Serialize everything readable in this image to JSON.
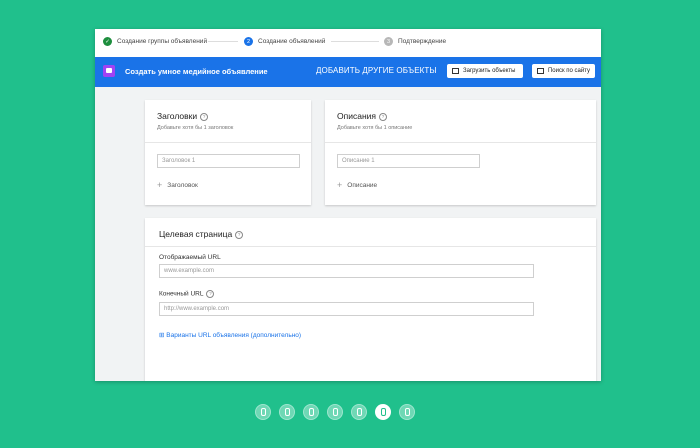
{
  "stepper": {
    "steps": [
      {
        "label": "Создание группы объявлений",
        "status": "done",
        "marker": "✓"
      },
      {
        "label": "Создание объявлений",
        "status": "current",
        "marker": "2"
      },
      {
        "label": "Подтверждение",
        "status": "pending",
        "marker": "3"
      }
    ]
  },
  "toolbar": {
    "title": "Создать умное медийное объявление",
    "add_assets": "ДОБАВИТЬ ДРУГИЕ ОБЪЕКТЫ",
    "upload_button": "Загрузить объекты",
    "search_button": "Поиск по сайту"
  },
  "headlines": {
    "title": "Заголовки",
    "hint": "Добавьте хотя бы 1 заголовок",
    "placeholder": "Заголовок 1",
    "add_label": "Заголовок"
  },
  "descriptions": {
    "title": "Описания",
    "hint": "Добавьте хотя бы 1 описание",
    "placeholder": "Описание 1",
    "add_label": "Описание"
  },
  "landing": {
    "title": "Целевая страница",
    "display_url_label": "Отображаемый URL",
    "display_url_placeholder": "www.example.com",
    "final_url_label": "Конечный URL",
    "final_url_placeholder": "http://www.example.com",
    "url_options_link": "Варианты URL объявления (дополнительно)"
  },
  "colors": {
    "background": "#20c08c",
    "accent": "#1a73e8",
    "done": "#1e8e3e"
  },
  "pagination": {
    "count": 7,
    "active_index": 6
  }
}
